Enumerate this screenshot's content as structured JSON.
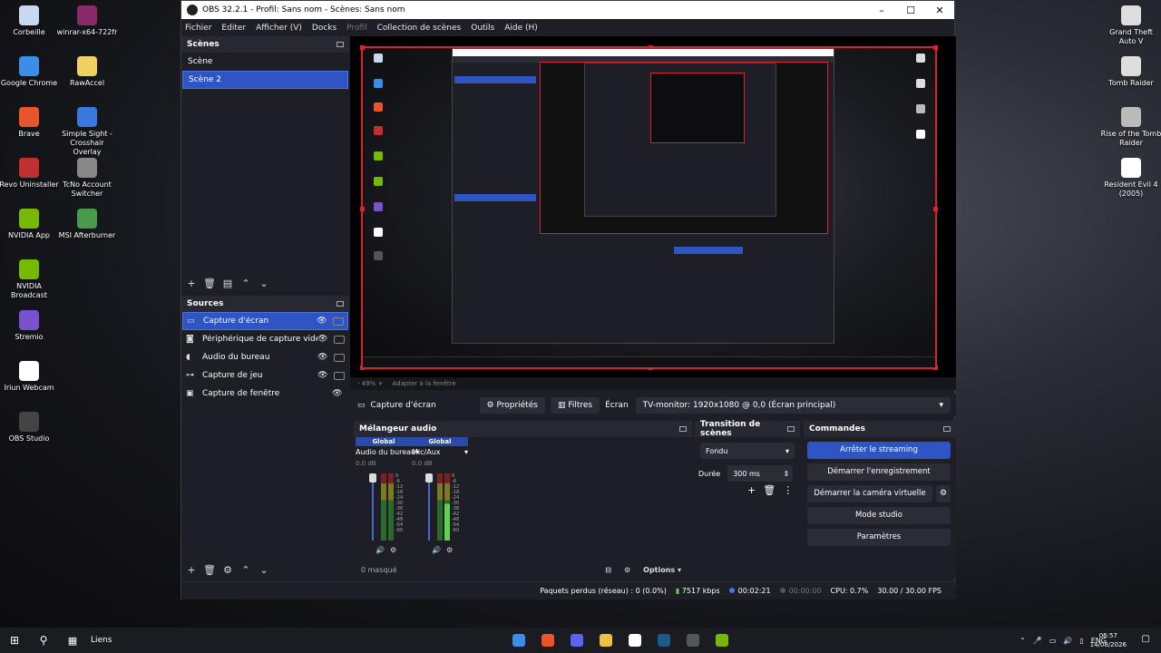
{
  "desktop": {
    "left_icons": [
      {
        "label": "Corbeille",
        "icon": "recycle-bin-icon",
        "color": "#c8d8f0"
      },
      {
        "label": "winrar-x64-722fr",
        "icon": "winrar-icon",
        "color": "#8a2a6a"
      },
      {
        "label": "Google Chrome",
        "icon": "chrome-icon",
        "color": "#3a8ee8"
      },
      {
        "label": "RawAccel",
        "icon": "folder-icon",
        "color": "#f0d060"
      },
      {
        "label": "Brave",
        "icon": "brave-icon",
        "color": "#e8552a"
      },
      {
        "label": "Simple Sight - Crosshair Overlay",
        "icon": "crosshair-icon",
        "color": "#3a78e0"
      },
      {
        "label": "Revo Uninstaller",
        "icon": "revo-icon",
        "color": "#c03030"
      },
      {
        "label": "TcNo Account Switcher",
        "icon": "tcno-icon",
        "color": "#888888"
      },
      {
        "label": "NVIDIA App",
        "icon": "nvidia-icon",
        "color": "#76b900"
      },
      {
        "label": "MSI Afterburner",
        "icon": "msi-icon",
        "color": "#4a9a4a"
      },
      {
        "label": "NVIDIA Broadcast",
        "icon": "nvidia-broadcast-icon",
        "color": "#76b900"
      },
      {
        "label": "Stremio",
        "icon": "stremio-icon",
        "color": "#7a52d0"
      },
      {
        "label": "Iriun Webcam",
        "icon": "webcam-icon",
        "color": "#ffffff"
      },
      {
        "label": "OBS Studio",
        "icon": "obs-icon",
        "color": "#444444"
      }
    ],
    "right_icons": [
      {
        "label": "Grand Theft Auto V",
        "icon": "gta-icon",
        "color": "#dddddd"
      },
      {
        "label": "Tomb Raider",
        "icon": "tomb-raider-icon",
        "color": "#dddddd"
      },
      {
        "label": "Rise of the Tomb Raider",
        "icon": "rise-tomb-raider-icon",
        "color": "#bbbbbb"
      },
      {
        "label": "Resident Evil 4 (2005)",
        "icon": "re4-icon",
        "color": "#ffffff"
      }
    ]
  },
  "window": {
    "title": "OBS 32.2.1 - Profil: Sans nom - Scènes: Sans nom",
    "controls": [
      "–",
      "☐",
      "✕"
    ]
  },
  "menu": [
    "Fichier",
    "Editer",
    "Afficher (V)",
    "Docks",
    "Profil",
    "Collection de scènes",
    "Outils",
    "Aide (H)"
  ],
  "scenes": {
    "title": "Scènes",
    "items": [
      {
        "label": "Scène",
        "selected": false
      },
      {
        "label": "Scène 2",
        "selected": true
      }
    ]
  },
  "sources": {
    "title": "Sources",
    "items": [
      {
        "label": "Capture d'écran",
        "icon": "monitor-icon",
        "selected": true
      },
      {
        "label": "Périphérique de capture vidéo",
        "icon": "camera-icon",
        "selected": false
      },
      {
        "label": "Audio du bureau",
        "icon": "speaker-icon",
        "selected": false
      },
      {
        "label": "Capture de jeu",
        "icon": "gamepad-icon",
        "selected": false
      },
      {
        "label": "Capture de fenêtre",
        "icon": "window-icon",
        "selected": false
      }
    ]
  },
  "preview": {
    "zoom": "- 49%  +",
    "fit": "Adapter à la fenêtre"
  },
  "context": {
    "source": "Capture d'écran",
    "properties": "Propriétés",
    "filters": "Filtres",
    "screen_label": "Écran",
    "screen_value": "TV-monitor: 1920x1080 @ 0,0 (Écran principal)"
  },
  "mixer": {
    "title": "Mélangeur audio",
    "channels": [
      {
        "group": "Global",
        "name": "Audio du bureau",
        "db": "0.0 dB"
      },
      {
        "group": "Global",
        "name": "Mic/Aux",
        "db": "0.0 dB"
      }
    ],
    "scale": [
      "0",
      "-6",
      "-12",
      "-18",
      "-24",
      "-30",
      "-36",
      "-42",
      "-48",
      "-54",
      "-60"
    ],
    "hidden": "0 masqué",
    "options": "Options"
  },
  "transitions": {
    "title": "Transition de scènes",
    "type": "Fondu",
    "duration_label": "Durée",
    "duration": "300 ms"
  },
  "controls": {
    "title": "Commandes",
    "buttons": [
      "Arrêter le streaming",
      "Démarrer l'enregistrement",
      "Démarrer la caméra virtuelle",
      "Mode studio",
      "Paramètres"
    ]
  },
  "status": {
    "dropped": "Paquets perdus (réseau) : 0 (0.0%)",
    "bitrate": "7517 kbps",
    "stream_time": "00:02:21",
    "rec_time": "00:00:00",
    "cpu": "CPU: 0.7%",
    "fps": "30.00 / 30.00 FPS"
  },
  "taskbar": {
    "links": "Liens",
    "apps": [
      {
        "icon": "chrome-taskbar-icon",
        "color": "#3a8ee8"
      },
      {
        "icon": "brave-taskbar-icon",
        "color": "#e8552a"
      },
      {
        "icon": "discord-taskbar-icon",
        "color": "#5865f2"
      },
      {
        "icon": "explorer-taskbar-icon",
        "color": "#f0c040"
      },
      {
        "icon": "calendar-taskbar-icon",
        "color": "#ffffff"
      },
      {
        "icon": "steam-taskbar-icon",
        "color": "#1b5a8a"
      },
      {
        "icon": "obs-taskbar-icon",
        "color": "#555555"
      },
      {
        "icon": "nvidia-taskbar-icon",
        "color": "#76b900"
      }
    ],
    "lang": "ENG",
    "time": "06:57",
    "date": "14/08/2026"
  }
}
